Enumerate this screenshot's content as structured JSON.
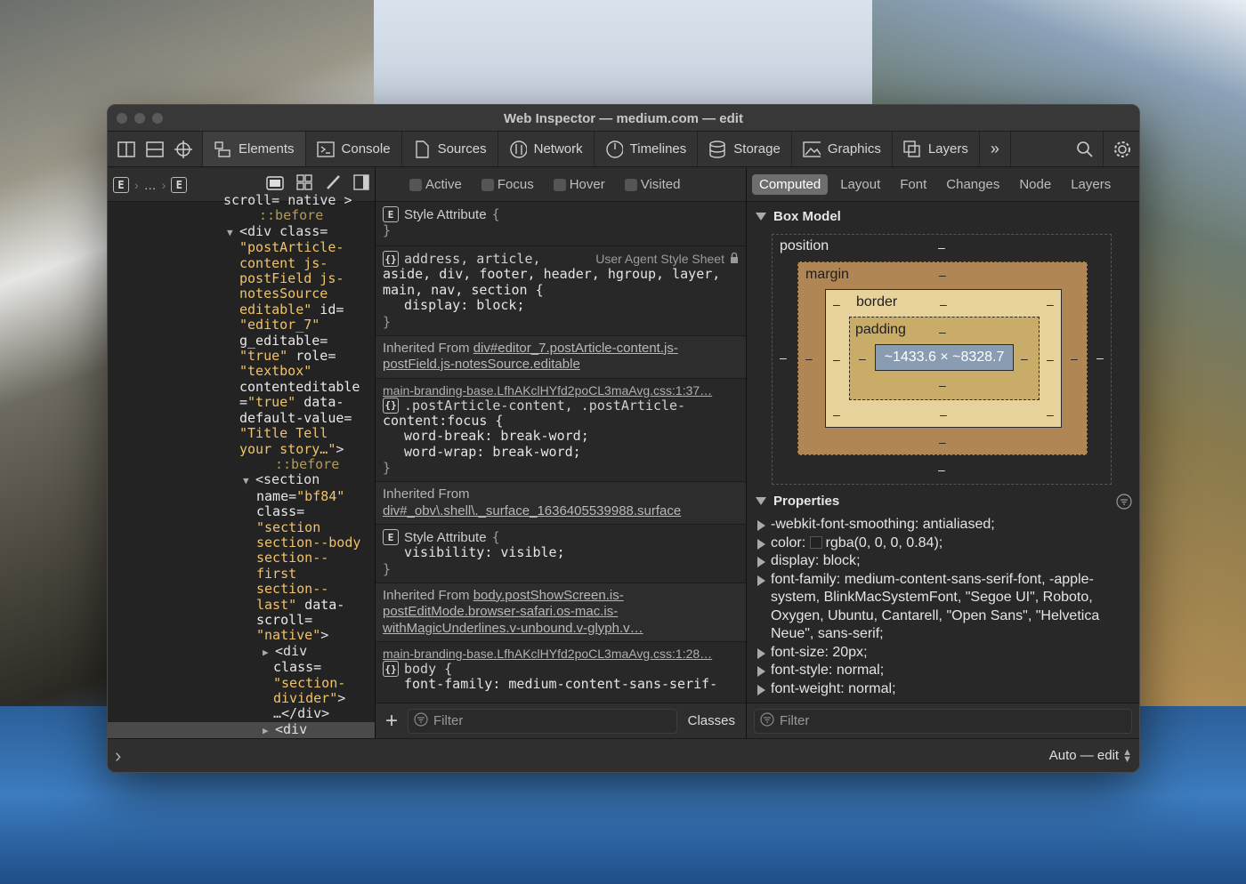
{
  "window": {
    "title": "Web Inspector — medium.com — edit"
  },
  "tabs": [
    {
      "label": "Elements",
      "icon": "elements-icon",
      "active": true
    },
    {
      "label": "Console",
      "icon": "console-icon"
    },
    {
      "label": "Sources",
      "icon": "sources-icon"
    },
    {
      "label": "Network",
      "icon": "network-icon"
    },
    {
      "label": "Timelines",
      "icon": "timelines-icon"
    },
    {
      "label": "Storage",
      "icon": "storage-icon"
    },
    {
      "label": "Graphics",
      "icon": "graphics-icon"
    },
    {
      "label": "Layers",
      "icon": "layers-icon"
    }
  ],
  "more_tabs": "»",
  "breadcrumb": {
    "start": "E",
    "ellipsis": "…",
    "end": "E"
  },
  "dom_lines": [
    {
      "kind": "text",
      "segments": [
        {
          "c": "tag",
          "t": "scroll= native >"
        }
      ]
    },
    {
      "kind": "pseudo",
      "segments": [
        {
          "c": "pseudo",
          "t": "::before"
        }
      ]
    },
    {
      "kind": "open",
      "segments": [
        {
          "c": "tag",
          "t": "<div class="
        }
      ]
    },
    {
      "kind": "cont",
      "segments": [
        {
          "c": "val",
          "t": "\"postArticle-"
        }
      ]
    },
    {
      "kind": "cont",
      "segments": [
        {
          "c": "val",
          "t": "content js-"
        }
      ]
    },
    {
      "kind": "cont",
      "segments": [
        {
          "c": "val",
          "t": "postField js-"
        }
      ]
    },
    {
      "kind": "cont",
      "segments": [
        {
          "c": "val",
          "t": "notesSource"
        }
      ]
    },
    {
      "kind": "cont",
      "segments": [
        {
          "c": "val",
          "t": "editable\""
        },
        {
          "c": "attr",
          "t": " id="
        }
      ]
    },
    {
      "kind": "cont",
      "segments": [
        {
          "c": "val",
          "t": "\"editor_7\""
        }
      ]
    },
    {
      "kind": "cont",
      "segments": [
        {
          "c": "attr",
          "t": "g_editable="
        }
      ]
    },
    {
      "kind": "cont",
      "segments": [
        {
          "c": "val",
          "t": "\"true\""
        },
        {
          "c": "attr",
          "t": " role="
        }
      ]
    },
    {
      "kind": "cont",
      "segments": [
        {
          "c": "val",
          "t": "\"textbox\""
        }
      ]
    },
    {
      "kind": "cont",
      "segments": [
        {
          "c": "attr",
          "t": "contenteditable"
        }
      ]
    },
    {
      "kind": "cont",
      "segments": [
        {
          "c": "attr",
          "t": "="
        },
        {
          "c": "val",
          "t": "\"true\""
        },
        {
          "c": "attr",
          "t": " data-"
        }
      ]
    },
    {
      "kind": "cont",
      "segments": [
        {
          "c": "attr",
          "t": "default-value="
        }
      ]
    },
    {
      "kind": "cont",
      "segments": [
        {
          "c": "val",
          "t": "\"Title Tell"
        }
      ]
    },
    {
      "kind": "cont",
      "segments": [
        {
          "c": "val",
          "t": "your story…\""
        },
        {
          "c": "tag",
          "t": ">"
        }
      ]
    },
    {
      "kind": "pseudo2",
      "segments": [
        {
          "c": "pseudo",
          "t": "::before"
        }
      ]
    },
    {
      "kind": "open2",
      "segments": [
        {
          "c": "tag",
          "t": "<section"
        }
      ]
    },
    {
      "kind": "cont2",
      "segments": [
        {
          "c": "attr",
          "t": "name="
        },
        {
          "c": "val",
          "t": "\"bf84\""
        }
      ]
    },
    {
      "kind": "cont2",
      "segments": [
        {
          "c": "attr",
          "t": "class="
        }
      ]
    },
    {
      "kind": "cont2",
      "segments": [
        {
          "c": "val",
          "t": "\"section"
        }
      ]
    },
    {
      "kind": "cont2",
      "segments": [
        {
          "c": "val",
          "t": "section--body"
        }
      ]
    },
    {
      "kind": "cont2",
      "segments": [
        {
          "c": "val",
          "t": "section--"
        }
      ]
    },
    {
      "kind": "cont2",
      "segments": [
        {
          "c": "val",
          "t": "first"
        }
      ]
    },
    {
      "kind": "cont2",
      "segments": [
        {
          "c": "val",
          "t": "section--"
        }
      ]
    },
    {
      "kind": "cont2",
      "segments": [
        {
          "c": "val",
          "t": "last\""
        },
        {
          "c": "attr",
          "t": " data-"
        }
      ]
    },
    {
      "kind": "cont2",
      "segments": [
        {
          "c": "attr",
          "t": "scroll="
        }
      ]
    },
    {
      "kind": "cont2",
      "segments": [
        {
          "c": "val",
          "t": "\"native\""
        },
        {
          "c": "tag",
          "t": ">"
        }
      ]
    },
    {
      "kind": "open3",
      "segments": [
        {
          "c": "tag",
          "t": "<div"
        }
      ]
    },
    {
      "kind": "cont3",
      "segments": [
        {
          "c": "attr",
          "t": "class="
        }
      ]
    },
    {
      "kind": "cont3",
      "segments": [
        {
          "c": "val",
          "t": "\"section-"
        }
      ]
    },
    {
      "kind": "cont3",
      "segments": [
        {
          "c": "val",
          "t": "divider\""
        },
        {
          "c": "tag",
          "t": ">"
        }
      ]
    },
    {
      "kind": "cont3",
      "segments": [
        {
          "c": "tag",
          "t": "…</div>"
        }
      ]
    },
    {
      "kind": "open3sel",
      "segments": [
        {
          "c": "tag",
          "t": "<div"
        }
      ]
    }
  ],
  "pseudo_states": [
    "Active",
    "Focus",
    "Hover",
    "Visited"
  ],
  "styles": {
    "style_attr_1": {
      "label": "Style Attribute",
      "open": "{",
      "close": "}"
    },
    "ua_rule": {
      "selector_lines": [
        "address, article,",
        "aside, div, footer, header, hgroup, layer,",
        "main, nav, section {"
      ],
      "origin": "User Agent Style Sheet",
      "props": [
        {
          "name": "display",
          "value": "block"
        }
      ],
      "close": "}"
    },
    "inherit_1": {
      "prefix": "Inherited From ",
      "link": "div#editor_7.postArticle-content.js-postField.js-notesSource.editable"
    },
    "rule_2": {
      "source": "main-branding-base.LfhAKclHYfd2poCL3maAvg.css:1:37…",
      "selector_lines": [
        ".postArticle-content, .postArticle-",
        "content:focus {"
      ],
      "props": [
        {
          "name": "word-break",
          "value": "break-word"
        },
        {
          "name": "word-wrap",
          "value": "break-word"
        }
      ],
      "close": "}"
    },
    "inherit_2": {
      "prefix": "Inherited From",
      "link": "div#_obv\\.shell\\._surface_1636405539988.surface"
    },
    "style_attr_2": {
      "label": "Style Attribute",
      "open": "{",
      "props": [
        {
          "name": "visibility",
          "value": "visible"
        }
      ],
      "close": "}"
    },
    "inherit_3": {
      "prefix": "Inherited From ",
      "link": "body.postShowScreen.is-postEditMode.browser-safari.os-mac.is-withMagicUnderlines.v-unbound.v-glyph.v…"
    },
    "rule_3": {
      "source": "main-branding-base.LfhAKclHYfd2poCL3maAvg.css:1:28…",
      "selector": "body {",
      "partial": "font-family: medium-content-sans-serif-"
    },
    "filter_placeholder": "Filter",
    "classes_label": "Classes",
    "add_label": "+"
  },
  "computed_tabs": [
    "Computed",
    "Layout",
    "Font",
    "Changes",
    "Node",
    "Layers"
  ],
  "box_model": {
    "title": "Box Model",
    "position_label": "position",
    "margin_label": "margin",
    "border_label": "border",
    "padding_label": "padding",
    "dash": "–",
    "content_size": "~1433.6 × ~8328.7"
  },
  "properties": {
    "title": "Properties",
    "items": [
      {
        "key": "-webkit-font-smoothing",
        "value": "antialiased"
      },
      {
        "key": "color",
        "value": "rgba(0, 0, 0, 0.84)",
        "swatch": "#000000"
      },
      {
        "key": "display",
        "value": "block"
      },
      {
        "key": "font-family",
        "value": "medium-content-sans-serif-font, -apple-system, BlinkMacSystemFont, \"Segoe UI\", Roboto, Oxygen, Ubuntu, Cantarell, \"Open Sans\", \"Helvetica Neue\", sans-serif"
      },
      {
        "key": "font-size",
        "value": "20px"
      },
      {
        "key": "font-style",
        "value": "normal"
      },
      {
        "key": "font-weight",
        "value": "normal"
      }
    ],
    "filter_placeholder": "Filter"
  },
  "bottom": {
    "left_chevron": "›",
    "mode": "Auto — edit",
    "stepper": "⌃⌄"
  }
}
